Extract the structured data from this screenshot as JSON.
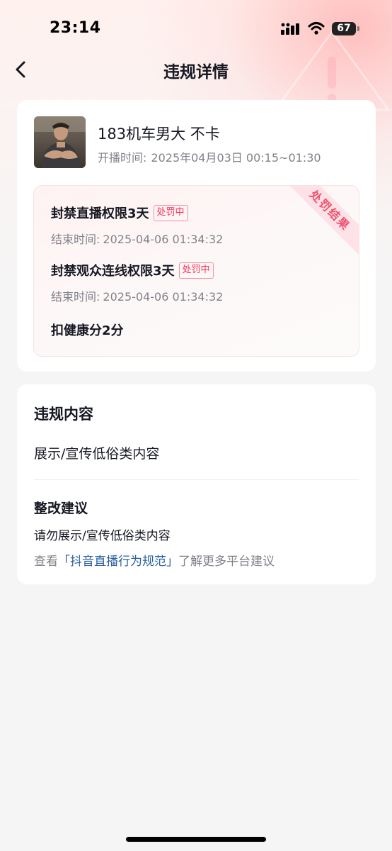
{
  "status_bar": {
    "time": "23:14",
    "battery": "67"
  },
  "nav": {
    "title": "违规详情"
  },
  "stream": {
    "name": "183机车男大 不卡",
    "time_label": "开播时间:",
    "time_value": "2025年04月03日 00:15~01:30"
  },
  "punishment": {
    "ribbon": "处罚结果",
    "items": [
      {
        "title": "封禁直播权限3天",
        "tag": "处罚中",
        "end_label": "结束时间:",
        "end_value": "2025-04-06 01:34:32"
      },
      {
        "title": "封禁观众连线权限3天",
        "tag": "处罚中",
        "end_label": "结束时间:",
        "end_value": "2025-04-06 01:34:32"
      },
      {
        "title": "扣健康分2分"
      }
    ]
  },
  "violation": {
    "section_title": "违规内容",
    "content": "展示/宣传低俗类内容",
    "advice_title": "整改建议",
    "advice_text": "请勿展示/宣传低俗类内容",
    "link_prefix": "查看",
    "link_text": "「抖音直播行为规范」",
    "link_suffix": "了解更多平台建议"
  },
  "colors": {
    "accent": "#fe2c55",
    "link": "#2b5f9e",
    "secondary_text": "#80828a"
  }
}
